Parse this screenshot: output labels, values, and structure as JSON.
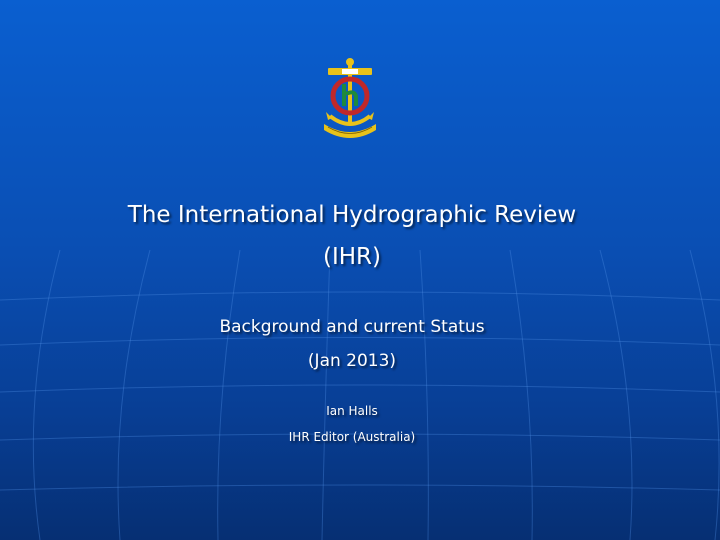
{
  "slide": {
    "title_line1": "The International Hydrographic  Review",
    "title_line2": "(IHR)",
    "subtitle_line1": "Background and current Status",
    "subtitle_line2": "(Jan 2013)",
    "author_name": "Ian Halls",
    "author_role": "IHR Editor (Australia)"
  },
  "emblem": {
    "icon": "iho-emblem-icon"
  },
  "colors": {
    "background_top": "#0a5fd0",
    "background_bottom": "#062f73",
    "text": "#ffffff",
    "emblem_red": "#c0282a",
    "emblem_gold": "#e8c21a",
    "emblem_green": "#1e8a3c"
  }
}
